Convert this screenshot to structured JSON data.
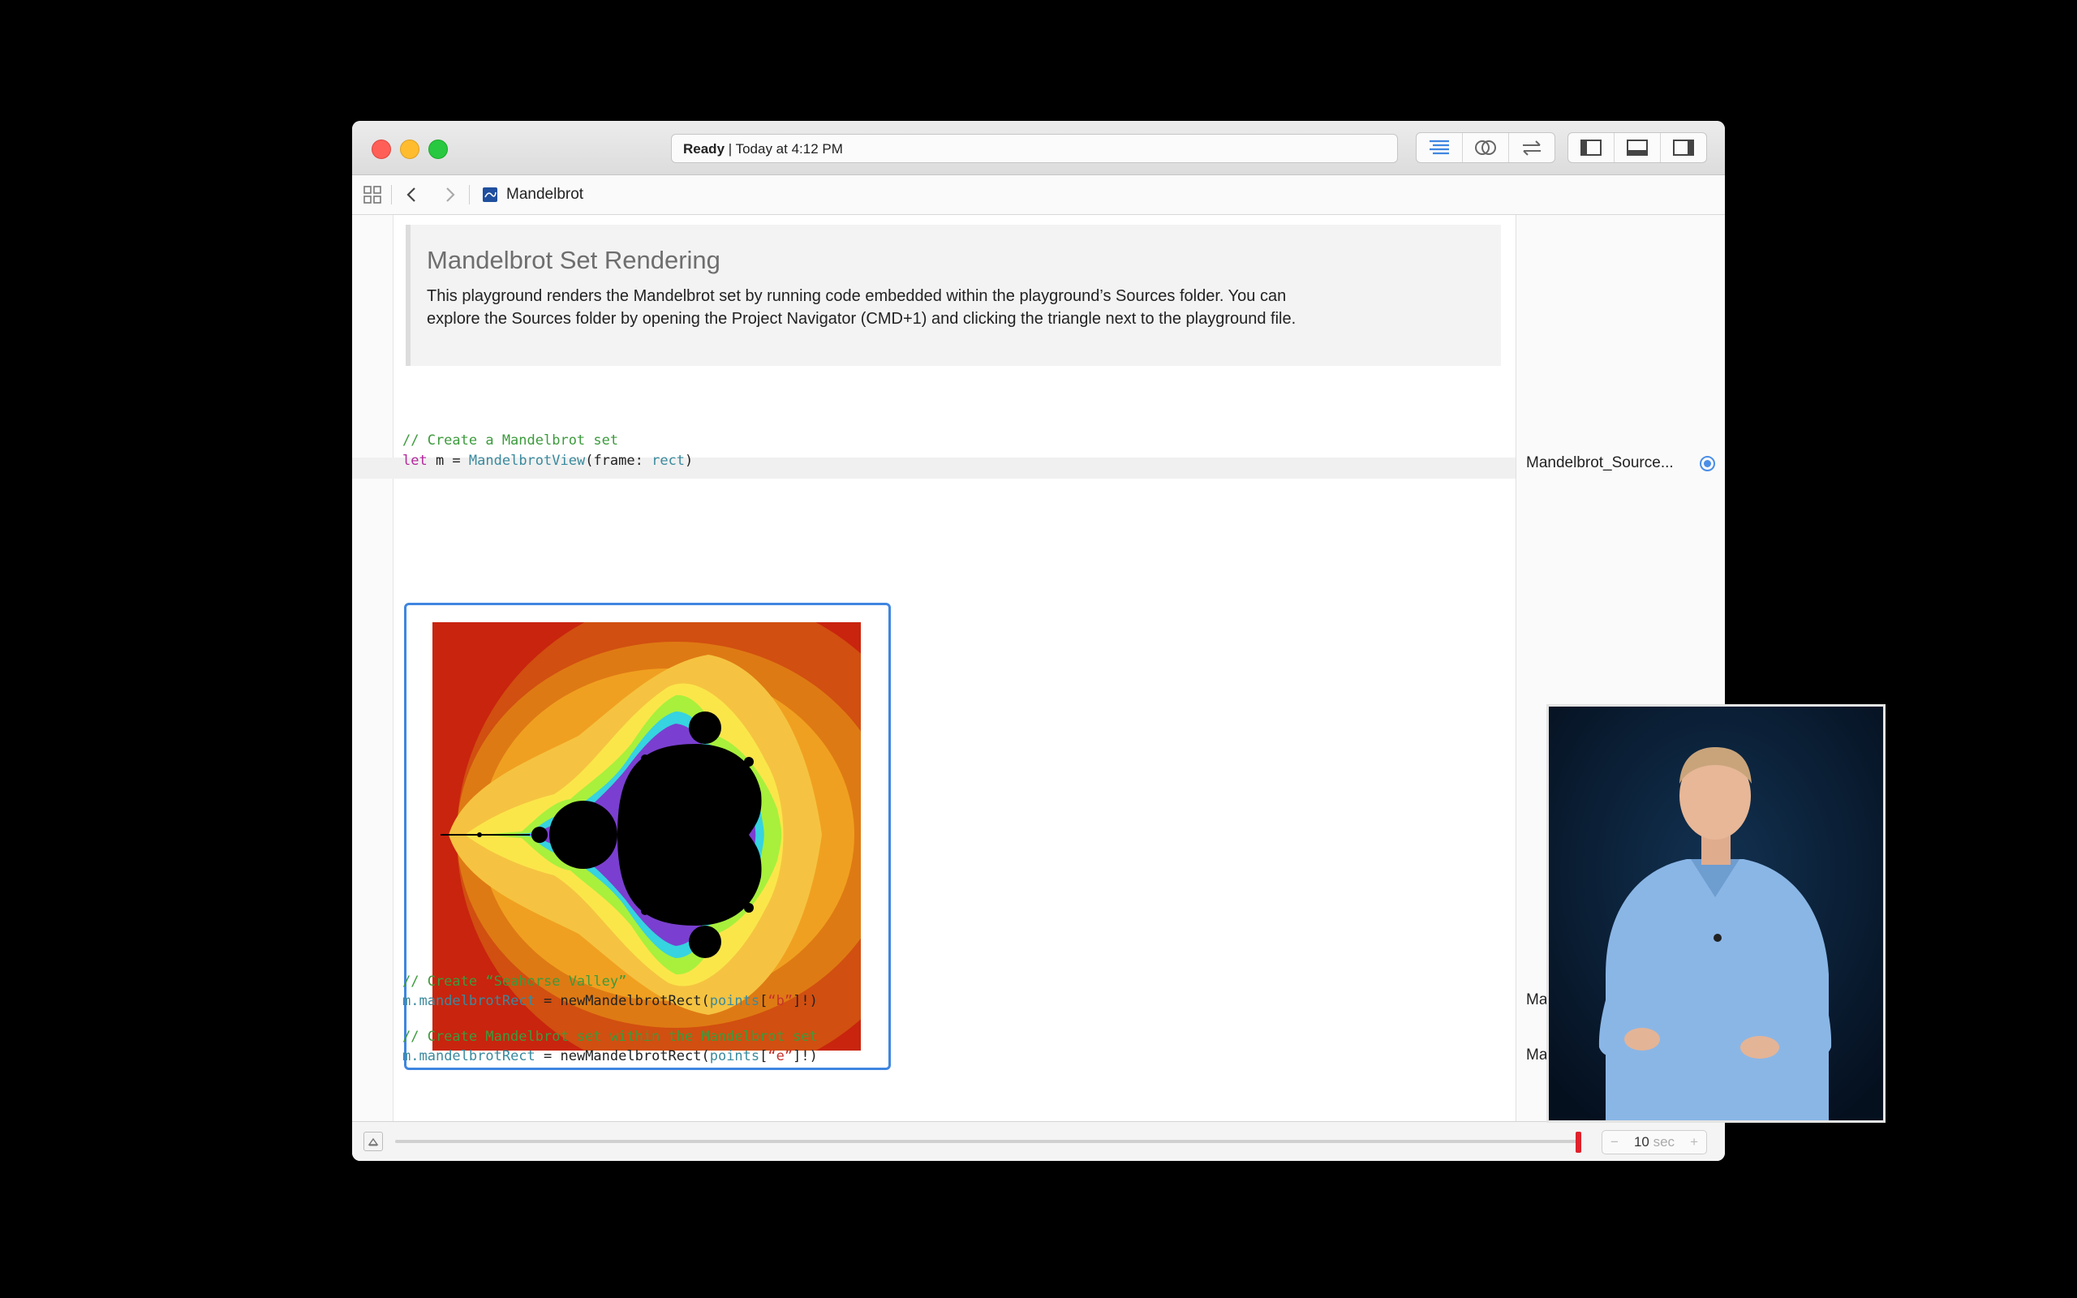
{
  "window": {
    "activity_status": "Ready",
    "activity_time": "| Today at 4:12 PM"
  },
  "navbar": {
    "breadcrumb_label": "Mandelbrot"
  },
  "markup": {
    "title": "Mandelbrot Set Rendering",
    "body_line1": "This playground renders the Mandelbrot set by running code embedded within the playground’s Sources folder. You can",
    "body_line2": "explore the Sources folder by opening the Project Navigator (CMD+1) and clicking the triangle next to the playground file."
  },
  "code": {
    "comment1": "// Create a Mandelbrot set",
    "line2_let": "let",
    "line2_m": " m = ",
    "line2_type": "MandelbrotView",
    "line2_frame": "(frame: ",
    "line2_rect": "rect",
    "line2_close": ")",
    "comment2": "// Create “Seahorse Valley”",
    "line4_m": "m.",
    "line4_prop": "mandelbrotRect",
    "line4_mid": " = newMandelbrotRect(",
    "line4_points": "points",
    "line4_open": "[",
    "line4_key": "“b”",
    "line4_close": "]!)",
    "comment3": "// Create Mandelbrot set within the Mandelbrot set",
    "line6_m": "m.",
    "line6_prop": "mandelbrotRect",
    "line6_mid": " = newMandelbrotRect(",
    "line6_points": "points",
    "line6_open": "[",
    "line6_key": "“e”",
    "line6_close": "]!)"
  },
  "results": {
    "result1": "Mandelbrot_Source...",
    "result2": "Ma",
    "result3": "Ma"
  },
  "timeline": {
    "value": "10",
    "unit": "sec",
    "minus": "−",
    "plus": "+"
  },
  "colors": {
    "accent": "#3f86e0",
    "comment": "#3c9b3c",
    "keyword": "#b3279c",
    "type": "#3a8a9e",
    "string": "#c6322c",
    "timeline_thumb": "#e0212b"
  },
  "icons": {
    "toolbar": [
      "standard-editor-icon",
      "assistant-editor-icon",
      "version-editor-icon",
      "navigator-panel-icon",
      "debug-panel-icon",
      "utilities-panel-icon"
    ],
    "navbar": [
      "related-items-grid-icon",
      "back-chevron-icon",
      "forward-chevron-icon",
      "playground-file-icon"
    ]
  }
}
